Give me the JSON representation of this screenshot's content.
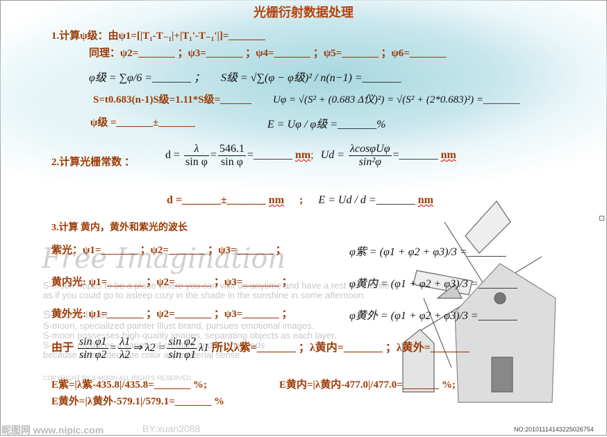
{
  "title": "光栅衍射数据处理",
  "s1": {
    "l1": "1.计算ψ级：由ψ1=[|T₁-T₋₁|+|T₁'-T₋₁'|]=_______",
    "l2": "同理：ψ2=_______ ；ψ3=_______ ；ψ4=_______ ；ψ5=_______ ；ψ6=_______",
    "l3a": "φ级 = ∑φ/6 =_______ ；",
    "l3b": "S级 = √∑(φ − φ级)² / n(n−1) =_______",
    "l4a": "S=t0.683(n-1)S级=1.11*S级=______",
    "l4b": "Uφ = √(S² + (0.683 Δ仪)²) = √(S² + (2*0.683)²) =_______",
    "l5a": "ψ级 =_______±_______",
    "l5b": "E = Uφ / φ级 =_______%"
  },
  "s2": {
    "label": "2.计算光栅常数 ：",
    "d_lhs": "d =",
    "lambda": "λ",
    "sin": "sin φ",
    "val": "546.1",
    "eq_blank": "=_______",
    "unit": "nm",
    "sep": ";",
    "ud_lhs": "Ud =",
    "ud_num": "λcosφUφ",
    "ud_den": "sin²φ",
    "l2a": "d =_______±_______",
    "l2b": "E = Ud / d =_______"
  },
  "s3": {
    "label": "3.计算 黄内，黄外和紫光的波长",
    "rows": [
      {
        "label": "紫光：ψ1=_______ ；ψ2=_______ ；ψ3=_______ ；",
        "formula": "φ紫 = (φ1 + φ2 + φ3)/3 =_______"
      },
      {
        "label": "黄内光: ψ1=_______ ；ψ2=_______ ；ψ3=_______ ；",
        "formula": "φ黄内 = (φ1 + φ2 + φ3)/3 =_______"
      },
      {
        "label": "黄外光: ψ1=_______ ；ψ2=_______ ；ψ3=_______ ；",
        "formula": "φ黄外 = (φ1 + φ2 + φ3)/3 =_______"
      }
    ],
    "since": "由于",
    "f1n": "sin φ1",
    "f1d": "sin φ2",
    "f2n": "λ1",
    "f2d": "λ2",
    "imp": "⇒ λ2 =",
    "f3n": "sin φ2",
    "f3d": "sin φ1",
    "l1": "λ1",
    "so": "所以λ紫=_______ ；λ黄内=_______ ；λ黄外=_______",
    "e1": "E紫=|λ紫-435.8|/435.8=_______ %;",
    "e2": "E黄内=|λ黄内-477.0|/477.0=_______ %;",
    "e3": "E黄外=|λ黄外-579.1|/579.1=_______ %"
  },
  "watermark": {
    "script": "Free Imagination",
    "p1": "S-moon hopes to be a place where you can visit us anytime and have a rest for a while",
    "p2": "as if you could go to asleep cozy in the shade in the sunshine in some afternoon.",
    "h": "S-moon Illust",
    "p3": "S-moon, specialized painter Illust brand, pursues emotional images.",
    "p4": "S-moon possesses high-quality images, separating objects as each layer.",
    "p5": "S-moon produces a variety of creative and fresh moods",
    "p6": "because of its adequate color and material sense",
    "copy": "COPYRIGHT BY S-MOON ALL RIGHTS RESERVED",
    "site": "昵图网 www.nipic.com",
    "by": "BY:xuan2088",
    "no": "NO:20101114143225026754"
  }
}
